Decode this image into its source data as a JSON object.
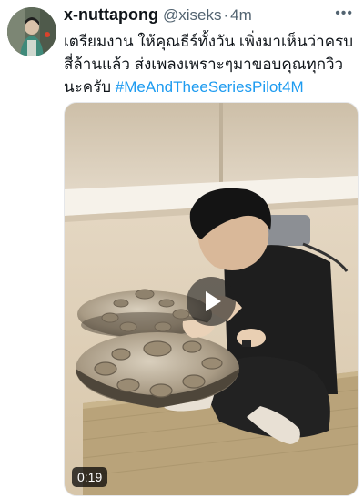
{
  "tweet": {
    "display_name": "x-nuttapong",
    "handle": "@xiseks",
    "separator": "·",
    "time": "4m",
    "more_icon": "more-horizontal-icon",
    "text_lines": [
      "เตรียมงาน ให้คุณธีร์ทั้งวัน เพิ่งมาเห็นว่าครบ",
      "สี่ล้านแล้ว ส่งเพลงเพราะๆมาขอบคุณทุกวิว",
      "นะครับ "
    ],
    "hashtag": "#MeAndTheeSeriesPilot4M",
    "hashtag_color": "#1d9bf0"
  },
  "media": {
    "type": "video",
    "play_icon": "play-icon",
    "duration": "0:19"
  }
}
